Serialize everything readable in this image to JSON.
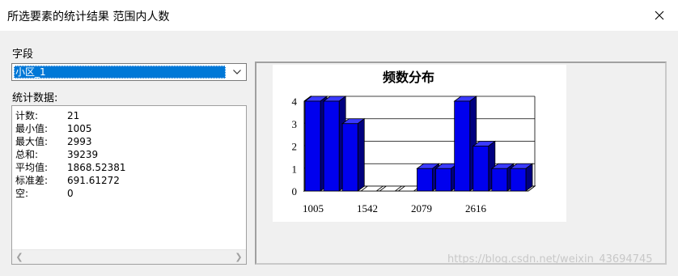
{
  "window": {
    "title": "所选要素的统计结果 范围内人数"
  },
  "field": {
    "label": "字段",
    "selected": "小区_1"
  },
  "stats": {
    "label": "统计数据:",
    "rows": [
      {
        "k": "计数:",
        "v": "21"
      },
      {
        "k": "最小值:",
        "v": "1005"
      },
      {
        "k": "最大值:",
        "v": "2993"
      },
      {
        "k": "总和:",
        "v": "39239"
      },
      {
        "k": "平均值:",
        "v": "1868.52381"
      },
      {
        "k": "标准差:",
        "v": "691.61272"
      },
      {
        "k": "空:",
        "v": "0"
      }
    ]
  },
  "chart_data": {
    "type": "bar",
    "title": "频数分布",
    "values": [
      4,
      4,
      3,
      0,
      0,
      0,
      1,
      1,
      4,
      2,
      1,
      1
    ],
    "y_ticks": [
      0,
      1,
      2,
      3,
      4
    ],
    "x_tick_labels": [
      "1005",
      "1542",
      "2079",
      "2616"
    ],
    "ylim": [
      0,
      4
    ],
    "grid": true,
    "bar_color": "#0000ee"
  },
  "watermark": "https://blog.csdn.net/weixin_43694745"
}
